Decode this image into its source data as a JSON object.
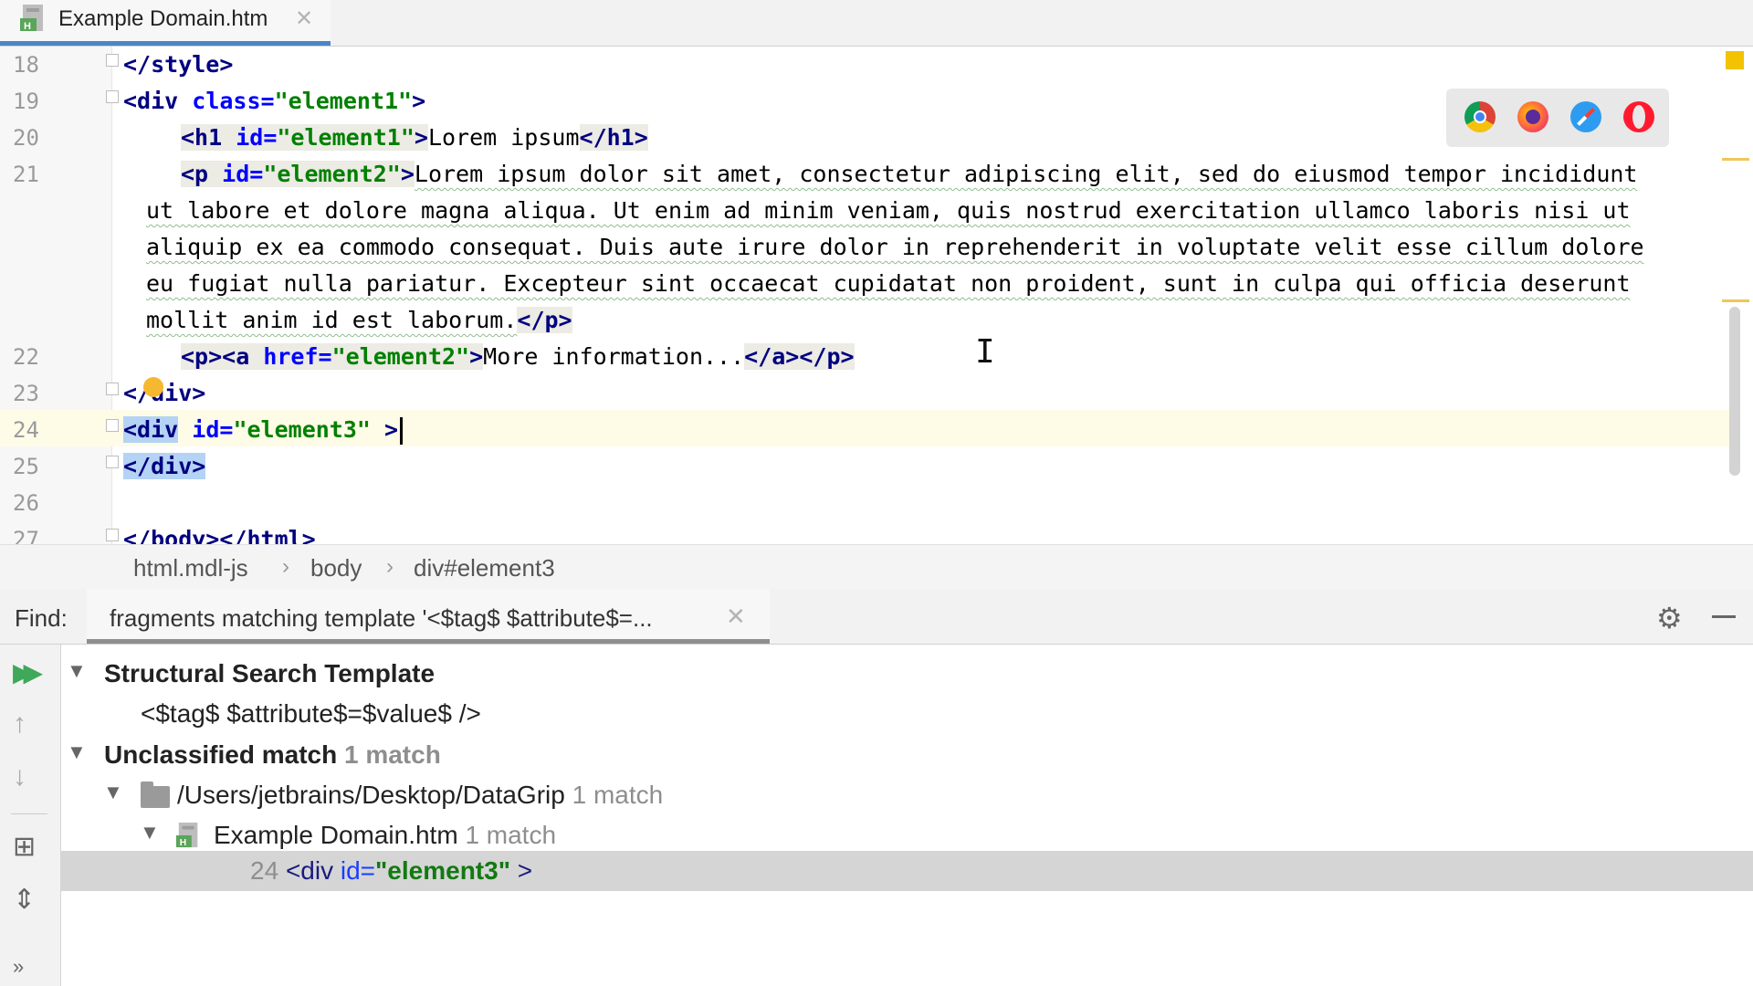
{
  "tab": {
    "title": "Example Domain.htm"
  },
  "editor": {
    "line_numbers": [
      "18",
      "19",
      "20",
      "21",
      "22",
      "23",
      "24",
      "25",
      "26",
      "27"
    ],
    "lines": {
      "l18": "</style>",
      "l19_tag": "<div",
      "l19_attr": "class=",
      "l19_val": "\"element1\"",
      "l19_end": ">",
      "l20_tag": "<h1",
      "l20_attr": "id=",
      "l20_val": "\"element1\"",
      "l20_close": ">",
      "l20_text": "Lorem ipsum",
      "l20_end": "</h1>",
      "l21_tag": "<p",
      "l21_attr": "id=",
      "l21_val": "\"element2\"",
      "l21_close": ">",
      "l21_text1": "Lorem ipsum dolor sit amet, consectetur adipiscing elit, sed do eiusmod tempor incididunt",
      "l21_text2": "ut labore et dolore magna aliqua. Ut enim ad minim veniam, quis nostrud exercitation ullamco laboris nisi ut",
      "l21_text3": "aliquip ex ea commodo consequat. Duis aute irure dolor in reprehenderit in voluptate velit esse cillum dolore",
      "l21_text4": "eu fugiat nulla pariatur. Excepteur sint occaecat cupidatat non proident, sunt in culpa qui officia deserunt",
      "l21_text5": "mollit anim id est laborum.",
      "l21_end": "</p>",
      "l22_tag": "<p><a",
      "l22_attr": "href=",
      "l22_val": "\"element2\"",
      "l22_close": ">",
      "l22_text": "More information...",
      "l22_end": "</a></p>",
      "l23": "</div>",
      "l24_tag": "<div",
      "l24_attr": "id=",
      "l24_val": "\"element3\"",
      "l24_end": " >",
      "l25": "</div>",
      "l27": "</body></html>"
    }
  },
  "breadcrumb": [
    "html.mdl-js",
    "body",
    "div#element3"
  ],
  "find": {
    "label": "Find:",
    "tab_title": "fragments matching template '<$tag$ $attribute$=..."
  },
  "results": {
    "template_heading": "Structural Search Template",
    "template_text": "<$tag$ $attribute$=$value$ />",
    "unclassified": "Unclassified match",
    "unclassified_count": "1 match",
    "folder": "/Users/jetbrains/Desktop/DataGrip",
    "folder_count": "1 match",
    "file": "Example Domain.htm",
    "file_count": "1 match",
    "match_line": "24",
    "match_tag": "<div",
    "match_attr": "id=",
    "match_val": "\"element3\"",
    "match_end": " >"
  },
  "colors": {
    "tag": "#000080",
    "attribute": "#0000ff",
    "value": "#008000",
    "accent": "#4a86c8"
  },
  "icons": [
    "html-file-icon",
    "chrome-icon",
    "firefox-icon",
    "safari-icon",
    "opera-icon",
    "gear-icon",
    "minimize-icon",
    "rerun-icon",
    "arrow-up-icon",
    "arrow-down-icon",
    "group-icon",
    "expand-icon",
    "more-icon",
    "folder-icon"
  ]
}
